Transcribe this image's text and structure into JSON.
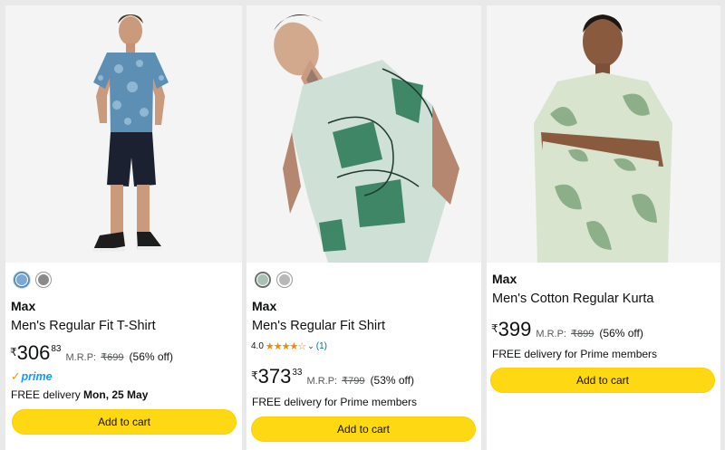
{
  "products": [
    {
      "brand": "Max",
      "title": "Men's Regular Fit T-Shirt",
      "swatches": [
        "#7aa9d6",
        "#8a8a8a"
      ],
      "price": {
        "symbol": "₹",
        "whole": "306",
        "fraction": "83",
        "mrp_label": "M.R.P:",
        "mrp": "₹699",
        "discount": "(56% off)"
      },
      "prime_label": "prime",
      "delivery_prefix": "FREE delivery",
      "delivery_date": "Mon, 25 May",
      "button": "Add to cart",
      "image_alt": "Model wearing blue printed t-shirt and black shorts"
    },
    {
      "brand": "Max",
      "title": "Men's Regular Fit Shirt",
      "swatches": [
        "#a9c1b3",
        "#b8b8b8"
      ],
      "rating": {
        "value": "4.0",
        "stars": "★★★★☆",
        "count": "(1)"
      },
      "price": {
        "symbol": "₹",
        "whole": "373",
        "fraction": "33",
        "mrp_label": "M.R.P:",
        "mrp": "₹799",
        "discount": "(53% off)"
      },
      "delivery": "FREE delivery for Prime members",
      "button": "Add to cart",
      "image_alt": "Model wearing green abstract print shirt"
    },
    {
      "brand": "Max",
      "title": "Men's Cotton Regular Kurta",
      "price": {
        "symbol": "₹",
        "whole": "399",
        "mrp_label": "M.R.P:",
        "mrp": "₹899",
        "discount": "(56% off)"
      },
      "delivery": "FREE delivery for Prime members",
      "button": "Add to cart",
      "image_alt": "Model wearing green leaf print shirt"
    }
  ]
}
